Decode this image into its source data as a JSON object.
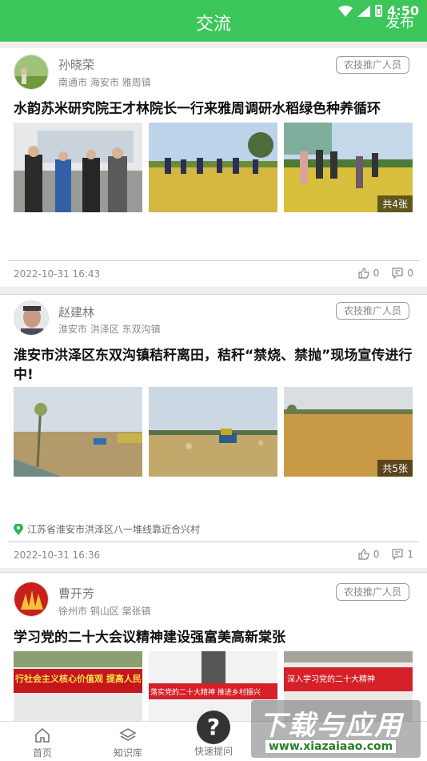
{
  "status_bar": {
    "time": "4:50"
  },
  "header": {
    "title": "交流",
    "publish_label": "发布"
  },
  "posts": [
    {
      "author": "孙晓荣",
      "location": "南通市 海安市 雅周镇",
      "role_tag": "农技推广人员",
      "title": "水韵苏米研究院王才林院长一行来雅周调研水稻绿色种养循环",
      "photo_count": "共4张",
      "address": "",
      "date": "2022-10-31 16:43",
      "likes": "0",
      "comments": "0"
    },
    {
      "author": "赵建林",
      "location": "淮安市 洪泽区 东双沟镇",
      "role_tag": "农技推广人员",
      "title": "淮安市洪泽区东双沟镇秸秆离田，秸秆“禁烧、禁抛”现场宣传进行中!",
      "photo_count": "共5张",
      "address": "江苏省淮安市洪泽区八一堆线靠近合兴村",
      "date": "2022-10-31 16:36",
      "likes": "0",
      "comments": "1"
    },
    {
      "author": "曹开芳",
      "location": "徐州市 铜山区 棠张镇",
      "role_tag": "农技推广人员",
      "title": "学习党的二十大会议精神建设强富美高新棠张",
      "photo_count": "",
      "address": "",
      "date": "",
      "likes": "",
      "comments": ""
    }
  ],
  "banner_texts": {
    "left": "行社会主义核心价值观  提高人民道德水准",
    "middle": "落实党的二十大精神 推进乡村振兴",
    "right": "深入学习党的二十大精神"
  },
  "bottom_nav": [
    {
      "label": "首页",
      "icon": "home-icon"
    },
    {
      "label": "知识库",
      "icon": "layers-icon"
    },
    {
      "label": "快速提问",
      "icon": "question-icon"
    }
  ],
  "watermark": {
    "line1": "下载与应用",
    "line2": "www.xiazaiaao.com"
  },
  "colors": {
    "brand_green": "#3cc65a",
    "pin_green": "#2db84d"
  }
}
